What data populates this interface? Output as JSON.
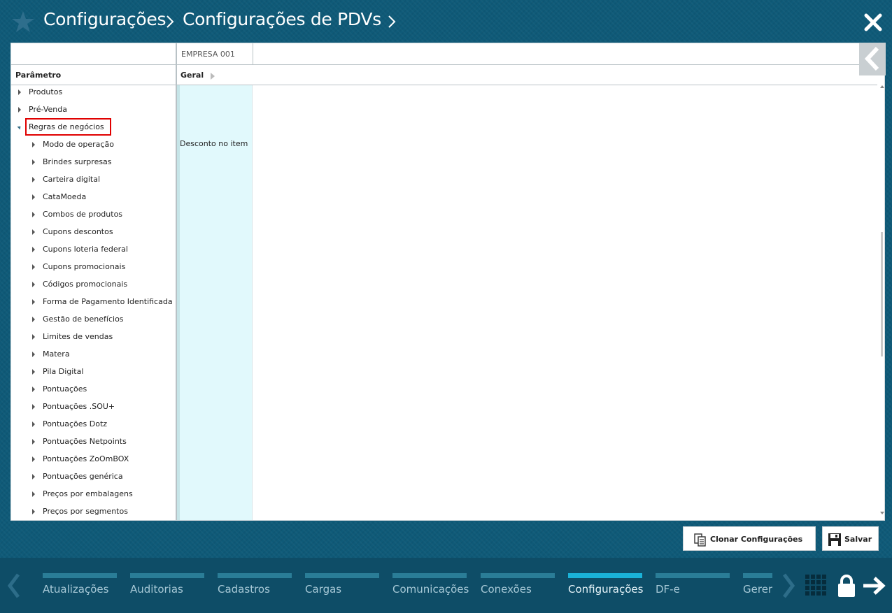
{
  "header": {
    "crumb1": "Configurações",
    "crumb2": "Configurações de PDVs",
    "star_icon": "star-icon",
    "close_icon": "close-icon"
  },
  "grid": {
    "empresa_header": "EMPRESA 001",
    "param_header": "Parâmetro",
    "geral_header": "Geral",
    "cell_value": "Desconto no item"
  },
  "tree": {
    "top": [
      {
        "label": "Produtos"
      },
      {
        "label": "Pré-Venda"
      },
      {
        "label": "Regras de negócios"
      }
    ],
    "children": [
      {
        "label": "Modo de operação"
      },
      {
        "label": "Brindes surpresas"
      },
      {
        "label": "Carteira digital"
      },
      {
        "label": "CataMoeda"
      },
      {
        "label": "Combos de produtos"
      },
      {
        "label": "Cupons descontos"
      },
      {
        "label": "Cupons loteria federal"
      },
      {
        "label": "Cupons promocionais"
      },
      {
        "label": "Códigos promocionais"
      },
      {
        "label": "Forma de Pagamento Identificada"
      },
      {
        "label": "Gestão de benefícios"
      },
      {
        "label": "Limites de vendas"
      },
      {
        "label": "Matera"
      },
      {
        "label": "Pila Digital"
      },
      {
        "label": "Pontuações"
      },
      {
        "label": "Pontuações .SOU+"
      },
      {
        "label": "Pontuações Dotz"
      },
      {
        "label": "Pontuações Netpoints"
      },
      {
        "label": "Pontuações ZoOmBOX"
      },
      {
        "label": "Pontuações genérica"
      },
      {
        "label": "Preços por embalagens"
      },
      {
        "label": "Preços por segmentos"
      }
    ]
  },
  "actions": {
    "clone_label": "Clonar Configurações",
    "save_label": "Salvar"
  },
  "bottom_nav": {
    "tabs": [
      {
        "label": "Atualizações"
      },
      {
        "label": "Auditorias"
      },
      {
        "label": "Cadastros"
      },
      {
        "label": "Cargas"
      },
      {
        "label": "Comunicações"
      },
      {
        "label": "Conexões"
      },
      {
        "label": "Configurações",
        "active": true
      },
      {
        "label": "DF-e"
      },
      {
        "label": "Gerer"
      }
    ]
  },
  "colors": {
    "background": "#0f5a78",
    "bottom_bar": "#0e4d67",
    "active_tab": "#1ab2d8",
    "tab_bar": "#2a7d97",
    "highlight": "#e00000",
    "column_fill": "#e1f9fc"
  }
}
